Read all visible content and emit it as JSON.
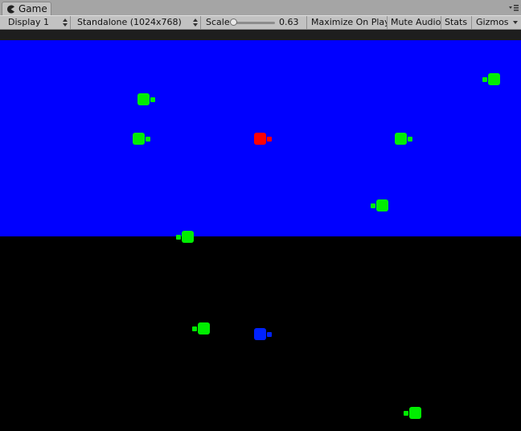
{
  "tab": {
    "label": "Game",
    "icon": "pacman-game-icon"
  },
  "toolbar": {
    "display": "Display 1",
    "resolution": "Standalone (1024x768)",
    "scale_label": "Scale",
    "scale_value": "0.63",
    "scale_fraction": 0.0,
    "maximize": "Maximize On Play",
    "mute": "Mute Audio",
    "stats": "Stats",
    "gizmos": "Gizmos"
  },
  "colors": {
    "sky": "#0000ff",
    "ground": "#000000",
    "player": "#ff0000",
    "enemy": "#00ee00",
    "ally": "#0022ff"
  },
  "sprites": [
    {
      "type": "enemy",
      "facing": "right"
    },
    {
      "type": "enemy",
      "facing": "left"
    },
    {
      "type": "enemy",
      "facing": "right"
    },
    {
      "type": "player",
      "facing": "right"
    },
    {
      "type": "enemy",
      "facing": "right"
    },
    {
      "type": "enemy",
      "facing": "left"
    },
    {
      "type": "enemy",
      "facing": "left"
    },
    {
      "type": "enemy",
      "facing": "left"
    },
    {
      "type": "ally",
      "facing": "right"
    },
    {
      "type": "enemy",
      "facing": "left"
    }
  ]
}
